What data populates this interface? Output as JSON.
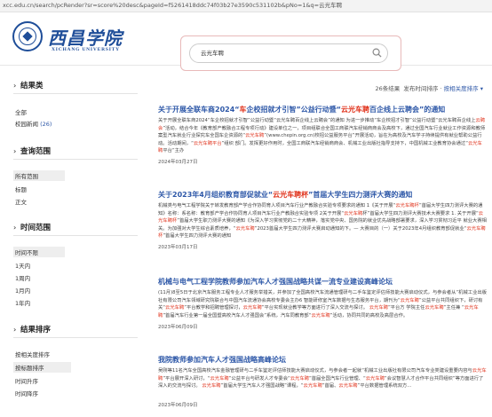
{
  "browser": {
    "url": "xcc.edu.cn/search/pcRender?sr=score%20desc&pageId=f5261418ddc74f03b27e3590c531102b&pNo=1&q=云光车聘"
  },
  "header": {
    "logo_text": "西昌学院",
    "logo_sub": "XICHANG UNIVERSITY"
  },
  "search": {
    "value": "云光车聘"
  },
  "toolbar": {
    "count_num": "26",
    "count_suffix": "条结果",
    "sort_time": "发布时间排序",
    "sort_relevance": "按相关度排序",
    "sep": "·"
  },
  "sidebar": {
    "scope": {
      "title": "结果类",
      "items": [
        {
          "label": "全部"
        },
        {
          "label": "校园新闻",
          "count": "(26)"
        }
      ]
    },
    "query": {
      "title": "查询范围",
      "items": [
        {
          "label": "所有范围"
        },
        {
          "label": "标题"
        },
        {
          "label": "正文"
        }
      ]
    },
    "time": {
      "title": "时间范围",
      "items": [
        {
          "label": "时间不限"
        },
        {
          "label": "1天内"
        },
        {
          "label": "1周内"
        },
        {
          "label": "1月内"
        },
        {
          "label": "1年内"
        }
      ]
    },
    "sort": {
      "title": "结果排序",
      "items": [
        {
          "label": "按相关度排序"
        },
        {
          "label": "按标题排序"
        },
        {
          "label": "时间升序"
        },
        {
          "label": "时间降序"
        }
      ]
    }
  },
  "results": [
    {
      "title_parts": [
        "关于开展全联车商2024“",
        "车",
        "企校招就才引智”公益行动暨“",
        "云光车聘",
        "百企线上云聘会”的通知"
      ],
      "body_parts": [
        "关于开展全联车商2024“车企校招就才引智”公益行动暨“云光车聘百企线上云聘会”的通知 为进一步推动“车企校招才引智”公益行动暨“云光车聘百企线上",
        "云聘会",
        "”活动，结合今年《教育部产教融合工程专项行动》建设单位之一，项目组联合全国工商联汽车经销商商会及高校下，通过全国汽车行业就业工作资源和教师案型汽车就业行业探究车全国车企资源的“",
        "云光车聘",
        "”(www.chepin.org.cn)校招公益服务平台”开展活动，旨在为高校及汽车学子持续提供有就业帮助公益行动。活动期间，“",
        "云光车聘平台",
        "”组织 部门。发挥更好作用时，全国工商联汽车经销商商会、机械工业出版社指导支持下，中国机械工业教育协会通过“",
        "云光车聘",
        "平台”主办"
      ],
      "date": "2024年03月27日"
    },
    {
      "title_parts": [
        "关于2023年4月组织教育部促就业“",
        "云光车聘杯",
        "”首届大学生四力测评大赛的通知"
      ],
      "body_parts": [
        "机械类与电气工程学院关于转发教育部产学合作协同育人项目汽车行业产教融合实验专项要求的通知 1《关于开展“",
        "云光车聘杯",
        "”首届大学生四力测评大赛的通知》名称：系名称：教育部产学合作协同育人项目汽车行业产教融合实验专项 2关于开展“",
        "云光车聘",
        "杯”首届大学生四力测评大赛技术大赛要求 1. 关于开展“",
        "云光车聘杯",
        "”首届大学生职力测评大赛的通知《为深入学习贯彻党的二十大精神，落实党中央、国务院的就业优先战略部署要求，深入学习贯彻习近平 就业大赛相关。为加强对大学生综合素质培养，“",
        "云光车聘",
        "”2023首届大学生四力测评大赛启动通知的下。— 大赛目的（一）关于2023年4月组织教育部促就业“",
        "云光车聘杯",
        "”首届大学生四力测评大赛的通知"
      ],
      "date": "2023年03月17日"
    },
    {
      "title_parts": [
        "机械与电气工程学院教师参加汽车人才强国战略共谋一流专业建设高峰论坛"
      ],
      "body_parts": [
        "(11月)8至5日于北京汽车服务工程专业人才服务举措关，并参加了全国高校汽车流通管理研与二手车鉴定评估师技能大赛启动仪式，与参会者从“机械工业出版社有限公司汽车领域研究院联合与中国汽车流通协会高校专委会主办6 智能研修室汽车数据与生态服务平台，期刊为“",
        "云光车聘",
        "”公益平台共同组织下，研讨有关“",
        "云光车聘",
        "”平台教学和招聘管理探讨，",
        "云光车聘",
        "”平台实现就业教学等方面进行了深入交流与探讨。 ",
        "云光车聘",
        "”平台方 学院主任",
        "云光车聘",
        "”主任兼 “",
        "云光车聘",
        "”首届汽车行业第一届全国暨高校汽车人才强国会”系统，汽车同教育部“",
        "云光车聘",
        "”活动，协同共同的高校及高层合作。"
      ],
      "date": "2023年06月09日"
    },
    {
      "title_parts": [
        "我院教师参加汽车人才强国战略高峰论坛"
      ],
      "body_parts": [
        "吴刚等11名汽车全国高校汽车金融管理研与二手车鉴定评估师技能大赛启动仪式，与参会者一起就“机械工业出版社有限公司汽车专业类建设重要内容与",
        "云光车聘",
        "”平台展开深入研讨，“",
        "云光车聘",
        "”公益平台与研发人才专委会“",
        "云光车聘",
        "”首届全国汽车行业管理、“",
        "云光车聘",
        "”会议智慧人才合作平台共同组织”等方面进行了深入的交流与探讨。 ",
        "云光车聘",
        "”首届大学生汽车人才强国战略”课程，“",
        "云光车聘",
        "”首届、",
        "云光车聘",
        "”平台数据管理系统双方..."
      ],
      "date": "2023年06月09日"
    }
  ]
}
